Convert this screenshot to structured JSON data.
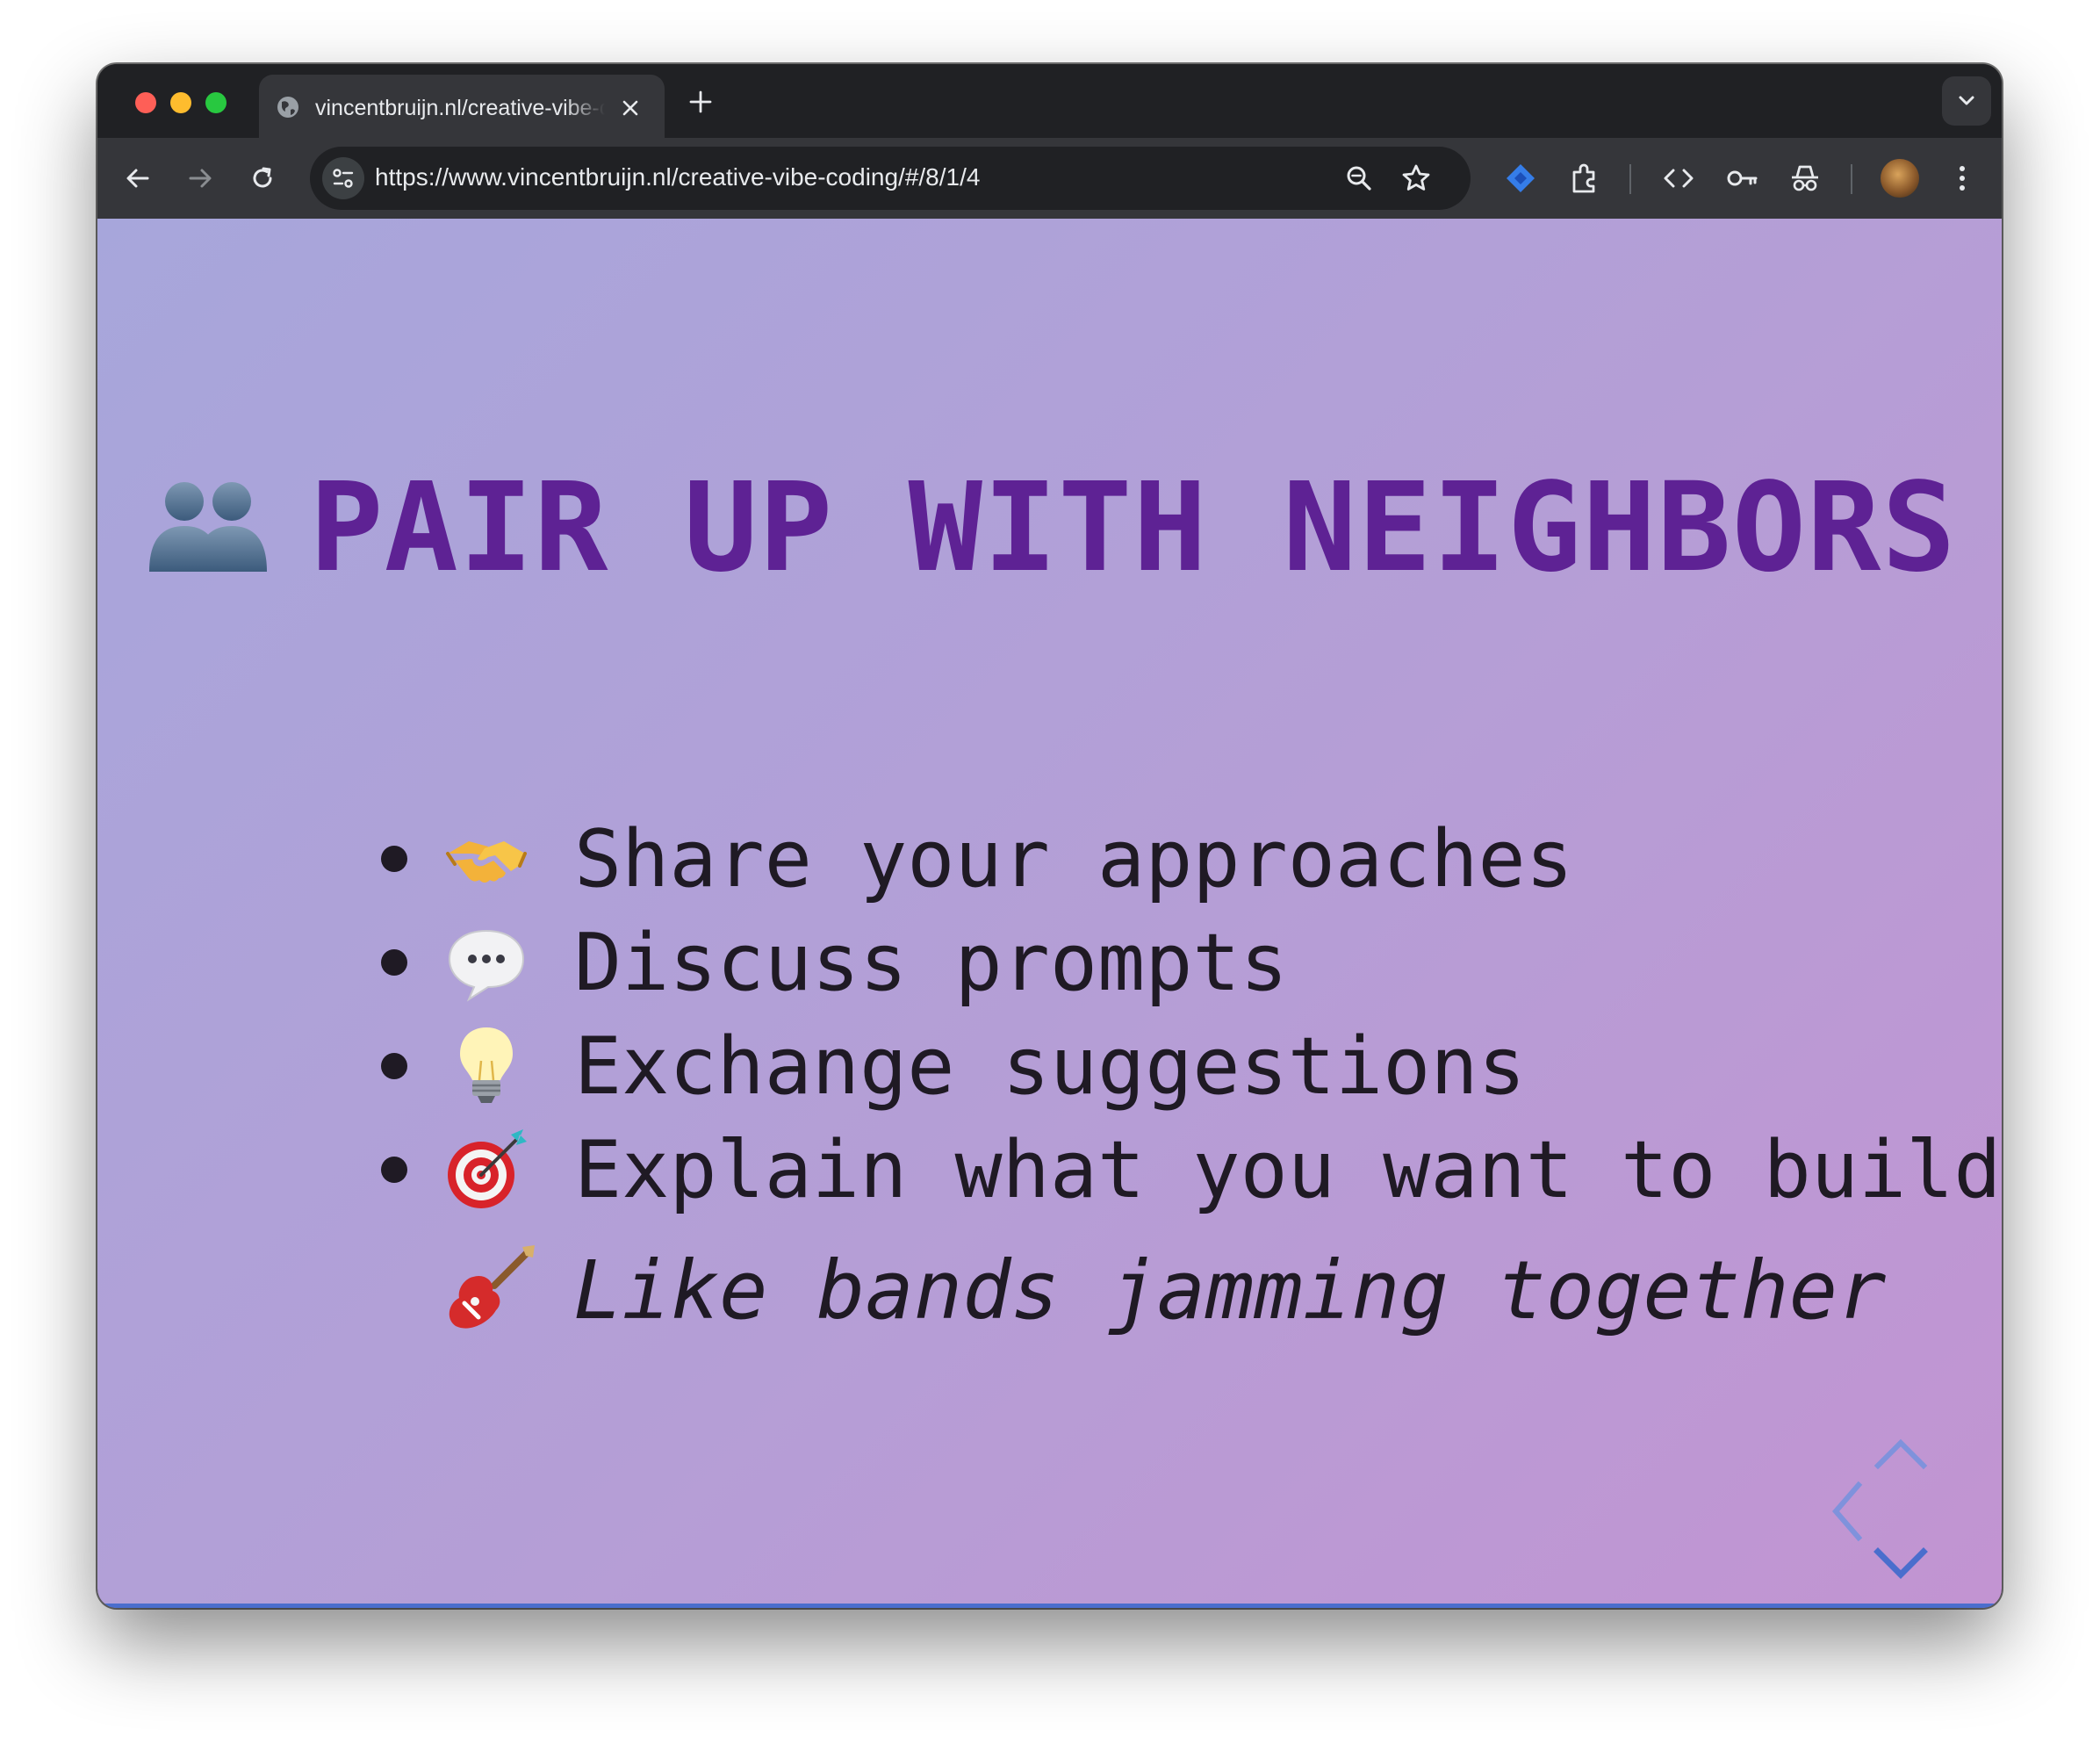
{
  "browser": {
    "tab_title": "vincentbruijn.nl/creative-vibe-coding",
    "url": "https://www.vincentbruijn.nl/creative-vibe-coding/#/8/1/4",
    "icons": [
      "globe-icon",
      "close-icon",
      "plus-icon",
      "chevron-down-icon",
      "back-arrow-icon",
      "forward-arrow-icon",
      "reload-icon",
      "site-settings-icon",
      "zoom-icon",
      "star-icon",
      "jira-icon",
      "extensions-icon",
      "code-icon",
      "password-key-icon",
      "incognito-icon",
      "avatar",
      "kebab-menu-icon"
    ]
  },
  "slide": {
    "title_emoji": "busts-in-silhouette",
    "title": "PAIR UP WITH NEIGHBORS",
    "bullets": [
      {
        "emoji": "handshake",
        "text": "Share your approaches"
      },
      {
        "emoji": "speech-balloon",
        "text": "Discuss prompts"
      },
      {
        "emoji": "light-bulb",
        "text": "Exchange suggestions"
      },
      {
        "emoji": "direct-hit",
        "text": "Explain what you want to build"
      }
    ],
    "tagline_emoji": "guitar",
    "tagline": "Like bands jamming together"
  },
  "colors": {
    "title": "#5e2294",
    "text": "#1f1a24",
    "background_start": "#a7a6db",
    "background_end": "#c294d2",
    "controls": "#6f86d6",
    "progress": "#4a6ecd"
  }
}
